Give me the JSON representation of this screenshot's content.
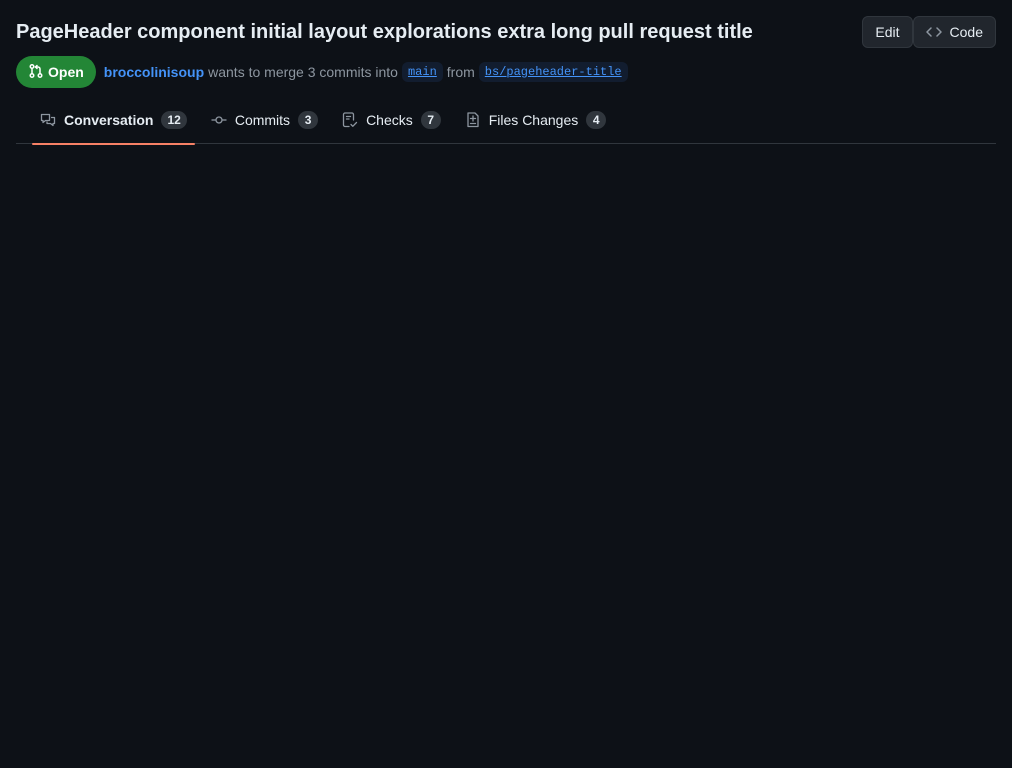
{
  "header": {
    "title": "PageHeader component initial layout explorations extra long pull request title",
    "actions": {
      "edit_label": "Edit",
      "code_label": "Code",
      "code_icon": "code-icon"
    }
  },
  "meta": {
    "state": {
      "label": "Open",
      "icon": "git-pull-request-icon",
      "color": "#238636"
    },
    "author": "broccolinisoup",
    "merge_text": "wants to merge 3 commits into",
    "base_branch": "main",
    "from_text": "from",
    "head_branch": "bs/pageheader-title"
  },
  "tabs": [
    {
      "label": "Conversation",
      "count": "12",
      "icon": "comment-discussion-icon",
      "selected": true
    },
    {
      "label": "Commits",
      "count": "3",
      "icon": "git-commit-icon",
      "selected": false
    },
    {
      "label": "Checks",
      "count": "7",
      "icon": "checklist-icon",
      "selected": false
    },
    {
      "label": "Files Changes",
      "count": "4",
      "icon": "file-diff-icon",
      "selected": false
    }
  ],
  "colors": {
    "background": "#0d1117",
    "accent_link": "#4493f8",
    "selected_tab_underline": "#f78166"
  }
}
